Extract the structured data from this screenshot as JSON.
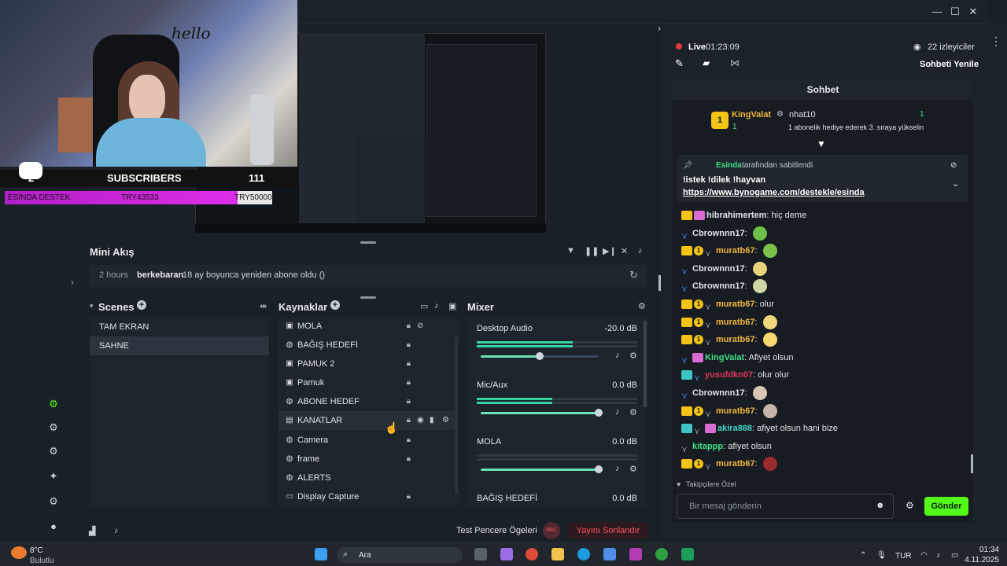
{
  "window": {
    "controls": [
      "—",
      "☐",
      "✕"
    ]
  },
  "webcam": {
    "hello_text": "hello",
    "sub_count_left": "2",
    "sub_label": "SUBSCRIBERS",
    "sub_count_right": "111",
    "goal_name": "ESİNDA DESTEK",
    "goal_current": "TRY43533",
    "goal_target": "TRY50000",
    "goal_progress": 0.87
  },
  "mini": {
    "title": "Mini Akış",
    "event_time": "2 hours",
    "event_user": "berkebaran",
    "event_text": "18 ay boyunca yeniden abone oldu ()"
  },
  "scenes": {
    "title": "Scenes",
    "items": [
      "TAM EKRAN",
      "SAHNE"
    ]
  },
  "sources": {
    "title": "Kaynaklar",
    "items": [
      "MOLA",
      "BAĞIŞ HEDEFİ",
      "PAMUK 2",
      "Pamuk",
      "ABONE HEDEF",
      "KANATLAR",
      "Camera",
      "frame",
      "ALERTS",
      "Display Capture"
    ]
  },
  "mixer": {
    "title": "Mixer",
    "channels": [
      {
        "name": "Desktop Audio",
        "db": "-20.0 dB",
        "level": 0.6,
        "volume": 0.5
      },
      {
        "name": "Mic/Aux",
        "db": "0.0 dB",
        "level": 0.47,
        "volume": 1.0
      },
      {
        "name": "MOLA",
        "db": "0.0 dB",
        "level": 0,
        "volume": 1.0
      },
      {
        "name": "BAĞIŞ HEDEFİ",
        "db": "0.0 dB",
        "level": 0,
        "volume": 1.0
      }
    ]
  },
  "bottom": {
    "test_label": "Test Pencere Ögeleri",
    "rec_label": "REC",
    "end_label": "Yayını Sonlandır"
  },
  "chat_panel": {
    "live_label": "Live",
    "live_time": "01:23:09",
    "viewers": "22 izleyiciler",
    "refresh_label": "Sohbeti Yenile",
    "title": "Sohbet",
    "gift_user": "KingValat",
    "gift_user_count": "1",
    "gift_target": "nhat10",
    "gift_count": "1",
    "gift_text": "1 abonelik hediye ederek 3. sıraya yükselin",
    "pinned_by": "Esinda",
    "pinned_suffix": "tarafından sabitlendi",
    "pinned_line1": "!istek !dilek !hayvan",
    "pinned_link": "https://www.bynogame.com/destekle/esinda",
    "followers_only": "Takipçilere Özel",
    "input_placeholder": "Bir mesaj gönderin",
    "send_label": "Gönder",
    "messages": [
      {
        "user": "hibrahimertem",
        "text": "hiç deme",
        "color": "white"
      },
      {
        "user": "Cbrownnn17",
        "text": "",
        "color": "white"
      },
      {
        "user": "muratb67",
        "text": "",
        "color": "yellow"
      },
      {
        "user": "Cbrownnn17",
        "text": "",
        "color": "white"
      },
      {
        "user": "Cbrownnn17",
        "text": "",
        "color": "white"
      },
      {
        "user": "muratb67",
        "text": "olur",
        "color": "yellow"
      },
      {
        "user": "muratb67",
        "text": "",
        "color": "yellow"
      },
      {
        "user": "muratb67",
        "text": "",
        "color": "yellow"
      },
      {
        "user": "KingValat",
        "text": "Afiyet olsun",
        "color": "green"
      },
      {
        "user": "yusufdkn07",
        "text": "olur olur",
        "color": "red"
      },
      {
        "user": "Cbrownnn17",
        "text": "",
        "color": "white"
      },
      {
        "user": "muratb67",
        "text": "",
        "color": "yellow"
      },
      {
        "user": "akira888",
        "text": "afiyet olsun hani bize",
        "color": "cyan"
      },
      {
        "user": "kitappp",
        "text": "afiyet olsun",
        "color": "green"
      },
      {
        "user": "muratb67",
        "text": "",
        "color": "yellow"
      }
    ]
  },
  "taskbar": {
    "weather_temp": "8°C",
    "weather_desc": "Bulutlu",
    "search_label": "Ara",
    "lang": "TUR",
    "time": "01:34",
    "date": "4.11.2025"
  },
  "colors": {
    "accent_green": "#53fc18",
    "mixer_green": "#36d29f",
    "live_red": "#e5383b",
    "goal_purple": "#dd2ee8"
  }
}
